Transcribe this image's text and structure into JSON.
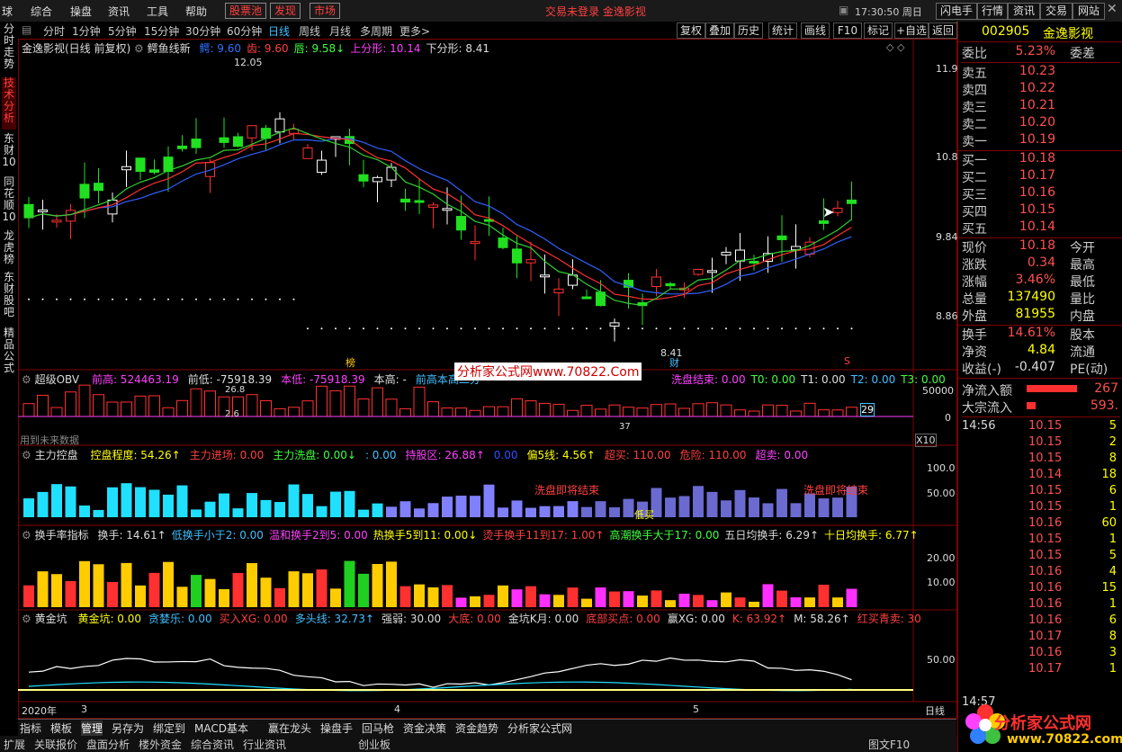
{
  "topbar": {
    "menu": [
      "球",
      "综合",
      "操盘",
      "资讯",
      "工具",
      "帮助"
    ],
    "boxed": [
      "股票池",
      "发现",
      "市场"
    ],
    "status": "交易未登录  金逸影视",
    "clock": "17:30:50 周日",
    "right_buttons": [
      "闪电手",
      "行情",
      "资讯",
      "交易",
      "网站"
    ]
  },
  "lefttabs": [
    "分时走势",
    "技术分析",
    "东财10",
    "同花顺10",
    "龙虎榜",
    "东财股吧",
    "精品公式"
  ],
  "periodbar": {
    "periods": [
      "分时",
      "1分钟",
      "5分钟",
      "15分钟",
      "30分钟",
      "60分钟",
      "日线",
      "周线",
      "月线",
      "多周期",
      "更多>"
    ],
    "actions": [
      "复权",
      "叠加",
      "历史",
      "统计",
      "画线",
      "F10",
      "标记",
      "+自选",
      "返回"
    ]
  },
  "main_chart": {
    "title": "金逸影视(日线 前复权)",
    "indicator": "鳄鱼线新",
    "params": [
      {
        "label": "鳄: 9.60",
        "color": "#3070ff"
      },
      {
        "label": "齿: 9.60",
        "color": "#ff4040"
      },
      {
        "label": "唇: 9.58↓",
        "color": "#40ff40"
      },
      {
        "label": "上分形: 10.14",
        "color": "#ff40ff"
      },
      {
        "label": "下分形: 8.41",
        "color": "#dddddd"
      }
    ],
    "yticks": [
      "11.91",
      "10.82",
      "9.84",
      "8.86"
    ],
    "high_label": "12.05",
    "low_label": "8.41",
    "markers": [
      "榜",
      "财",
      "S"
    ]
  },
  "obv_panel": {
    "name": "超级OBV",
    "params": [
      {
        "label": "前高: 524463.19",
        "color": "#ff40ff"
      },
      {
        "label": "前低: -75918.39",
        "color": "#dddddd"
      },
      {
        "label": "本低: -75918.39",
        "color": "#ff40ff"
      },
      {
        "label": "本高: -",
        "color": "#dddddd"
      },
      {
        "label": "前高本高二分",
        "color": "#40c0ff"
      }
    ],
    "params_right": [
      {
        "label": "洗盘结束: 0.00",
        "color": "#ff40ff"
      },
      {
        "label": "T0: 0.00",
        "color": "#40ff40"
      },
      {
        "label": "T1: 0.00",
        "color": "#dddddd"
      },
      {
        "label": "T2: 0.00",
        "color": "#40c0ff"
      },
      {
        "label": "T3: 0.00",
        "color": "#40ff40"
      }
    ],
    "yticks": [
      "50000",
      "0"
    ],
    "labels": [
      "26.8",
      "2.6",
      "37",
      "29"
    ],
    "note": "用到未来数据",
    "x10": "X10"
  },
  "control_panel": {
    "name": "主力控盘",
    "params": [
      {
        "label": "控盘程度: 54.26↑",
        "color": "#ffff00"
      },
      {
        "label": "主力进场: 0.00",
        "color": "#ff4040"
      },
      {
        "label": "主力洗盘: 0.00↓",
        "color": "#40ff40"
      },
      {
        "label": ": 0.00",
        "color": "#40c0ff"
      },
      {
        "label": "持股区: 26.88↑",
        "color": "#ff40ff"
      },
      {
        "label": "0.00",
        "color": "#3050ff"
      },
      {
        "label": "偏5线: 4.56↑",
        "color": "#ffff00"
      },
      {
        "label": "超买: 110.00",
        "color": "#ff4040"
      },
      {
        "label": "危险: 110.00",
        "color": "#ff4040"
      },
      {
        "label": "超卖: 0.00",
        "color": "#ff40ff"
      }
    ],
    "yticks": [
      "100.0",
      "50.00"
    ],
    "annotations": [
      "洗盘即将结束",
      "低买",
      "洗盘即将结束"
    ]
  },
  "turnover_panel": {
    "name": "换手率指标",
    "params": [
      {
        "label": "换手: 14.61↑",
        "color": "#dddddd"
      },
      {
        "label": "低换手小于2: 0.00",
        "color": "#40c0ff"
      },
      {
        "label": "温和换手2到5: 0.00",
        "color": "#ff40ff"
      },
      {
        "label": "热换手5到11: 0.00↓",
        "color": "#ffff00"
      },
      {
        "label": "烫手换手11到17: 1.00↑",
        "color": "#ff4040"
      },
      {
        "label": "高潮换手大于17: 0.00",
        "color": "#40ff40"
      },
      {
        "label": "五日均换手: 6.29↑",
        "color": "#dddddd"
      },
      {
        "label": "十日均换手: 6.77↑",
        "color": "#ffff00"
      }
    ],
    "yticks": [
      "20.00",
      "10.00"
    ]
  },
  "golden_panel": {
    "name": "黄金坑",
    "params": [
      {
        "label": "黄金坑: 0.00",
        "color": "#ffff00"
      },
      {
        "label": "贪婪乐: 0.00",
        "color": "#40c0ff"
      },
      {
        "label": "买入XG: 0.00",
        "color": "#ff4040"
      },
      {
        "label": "多头线: 32.73↑",
        "color": "#40c0ff"
      },
      {
        "label": "强弱: 30.00",
        "color": "#dddddd"
      },
      {
        "label": "大底: 0.00",
        "color": "#ff4040"
      },
      {
        "label": "金坑K月: 0.00",
        "color": "#dddddd"
      },
      {
        "label": "底部买点: 0.00",
        "color": "#ff4040"
      },
      {
        "label": "赢XG: 0.00",
        "color": "#dddddd"
      },
      {
        "label": "K: 63.92↑",
        "color": "#ff4040"
      },
      {
        "label": "M: 58.26↑",
        "color": "#dddddd"
      },
      {
        "label": "红买青卖: 30",
        "color": "#ff4040"
      }
    ],
    "yticks": [
      "50.00"
    ]
  },
  "xaxis": {
    "year": "2020年",
    "months": [
      "3",
      "4",
      "5"
    ],
    "day": "日线"
  },
  "bottom_tabs": [
    "指标",
    "模板",
    "管理",
    "另存为",
    "绑定到",
    "MACD基本",
    "赢在龙头",
    "操盘手",
    "回马枪",
    "资金决策",
    "资金趋势",
    "分析家公式网"
  ],
  "bottom_tabs2": [
    "扩展",
    "关联报价",
    "盘面分析",
    "楼外资金",
    "综合资讯",
    "行业资讯",
    "图文F10",
    "创业板"
  ],
  "watermark": "分析家公式网www.70822.Com",
  "quote": {
    "code": "002905",
    "name": "金逸影视",
    "weibi": {
      "label": "委比",
      "value": "5.23%",
      "label2": "委差"
    },
    "sells": [
      {
        "label": "卖五",
        "price": "10.23"
      },
      {
        "label": "卖四",
        "price": "10.22"
      },
      {
        "label": "卖三",
        "price": "10.21"
      },
      {
        "label": "卖二",
        "price": "10.20"
      },
      {
        "label": "卖一",
        "price": "10.19"
      }
    ],
    "buys": [
      {
        "label": "买一",
        "price": "10.18"
      },
      {
        "label": "买二",
        "price": "10.17"
      },
      {
        "label": "买三",
        "price": "10.16"
      },
      {
        "label": "买四",
        "price": "10.15"
      },
      {
        "label": "买五",
        "price": "10.14"
      }
    ],
    "stats": [
      {
        "l1": "现价",
        "v1": "10.18",
        "l2": "今开"
      },
      {
        "l1": "涨跌",
        "v1": "0.34",
        "l2": "最高"
      },
      {
        "l1": "涨幅",
        "v1": "3.46%",
        "l2": "最低"
      },
      {
        "l1": "总量",
        "v1": "137490",
        "l2": "量比"
      },
      {
        "l1": "外盘",
        "v1": "81955",
        "l2": "内盘"
      }
    ],
    "stats2": [
      {
        "l1": "换手",
        "v1": "14.61%",
        "l2": "股本"
      },
      {
        "l1": "净资",
        "v1": "4.84",
        "l2": "流通"
      },
      {
        "l1": "收益(-)",
        "v1": "-0.407",
        "l2": "PE(动)"
      }
    ],
    "flow": [
      {
        "label": "净流入额",
        "value": "267"
      },
      {
        "label": "大宗流入",
        "value": "593."
      }
    ],
    "tick_time": "14:56",
    "ticks": [
      {
        "p": "10.15",
        "v": "5"
      },
      {
        "p": "10.15",
        "v": "2"
      },
      {
        "p": "10.15",
        "v": "8"
      },
      {
        "p": "10.14",
        "v": "18"
      },
      {
        "p": "10.15",
        "v": "6"
      },
      {
        "p": "10.15",
        "v": "1"
      },
      {
        "p": "10.16",
        "v": "60"
      },
      {
        "p": "10.15",
        "v": "1"
      },
      {
        "p": "10.15",
        "v": "5"
      },
      {
        "p": "10.16",
        "v": "4"
      },
      {
        "p": "10.16",
        "v": "15"
      },
      {
        "p": "10.16",
        "v": "1"
      },
      {
        "p": "10.16",
        "v": "6"
      },
      {
        "p": "10.17",
        "v": "8"
      },
      {
        "p": "10.16",
        "v": "3"
      },
      {
        "p": "10.17",
        "v": "1"
      }
    ],
    "tick_time2": "14:57",
    "logo_text": "分析家公式网",
    "logo_url": "www.70822.com"
  }
}
